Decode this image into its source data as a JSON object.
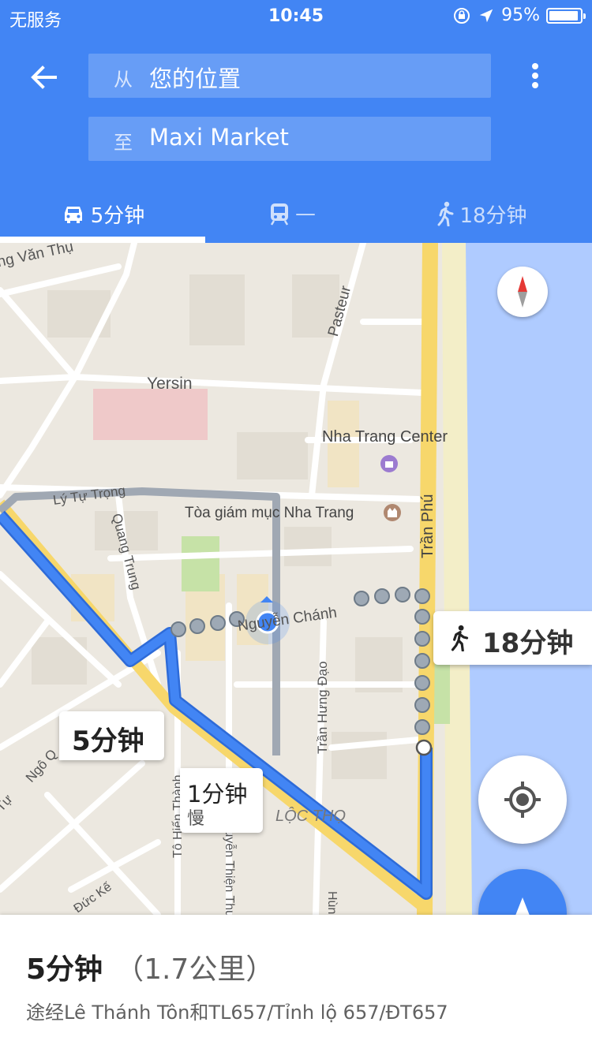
{
  "status_bar": {
    "carrier": "无服务",
    "time": "10:45",
    "battery_text": "95%",
    "battery_level": 0.95
  },
  "search": {
    "from_prefix": "从",
    "from_value": "您的位置",
    "to_prefix": "至",
    "to_value": "Maxi Market"
  },
  "tabs": [
    {
      "label": "5分钟",
      "icon": "car-icon",
      "selected": true
    },
    {
      "label": "—",
      "icon": "train-icon",
      "selected": false
    },
    {
      "label": "18分钟",
      "icon": "walk-icon",
      "selected": false
    }
  ],
  "map": {
    "labels": {
      "van_thu": "ng Văn Thụ",
      "pasteur": "Pasteur",
      "yersin": "Yersin",
      "nha_trang_center": "Nha Trang Center",
      "tran_phu": "Trần Phú",
      "ly_tu_trong": "Lý Tự Trọng",
      "toa_giam_muc": "Tòa giám mục Nha Trang",
      "quang_trung": "Quang Trung",
      "nguyen_chanh": "Nguyễn Chánh",
      "tran_hung_dao": "Trần Hưng Đạo",
      "ngo": "Ngô Q",
      "tu": "Tự",
      "to_hien_thanh": "Tô Hiến Thành",
      "nguyen_thien_thuat": "Nguyễn Thiện Thuật",
      "loc_tho": "LỘC THỌ",
      "duc_ke": "Đức Kế",
      "hung": "Hùng"
    },
    "callouts": {
      "walk_time": "18分钟",
      "drive_time": "5分钟",
      "alt_time": "1分钟",
      "alt_note": "慢"
    },
    "colors": {
      "route": "#4285F4",
      "alt_route": "#A0A8B3",
      "water": "#AFCBFF",
      "main_road": "#F7D76B"
    }
  },
  "bottom": {
    "duration": "5分钟",
    "distance": "（1.7公里）",
    "via": "途经Lê Thánh Tôn和TL657/Tỉnh lộ 657/ĐT657"
  }
}
